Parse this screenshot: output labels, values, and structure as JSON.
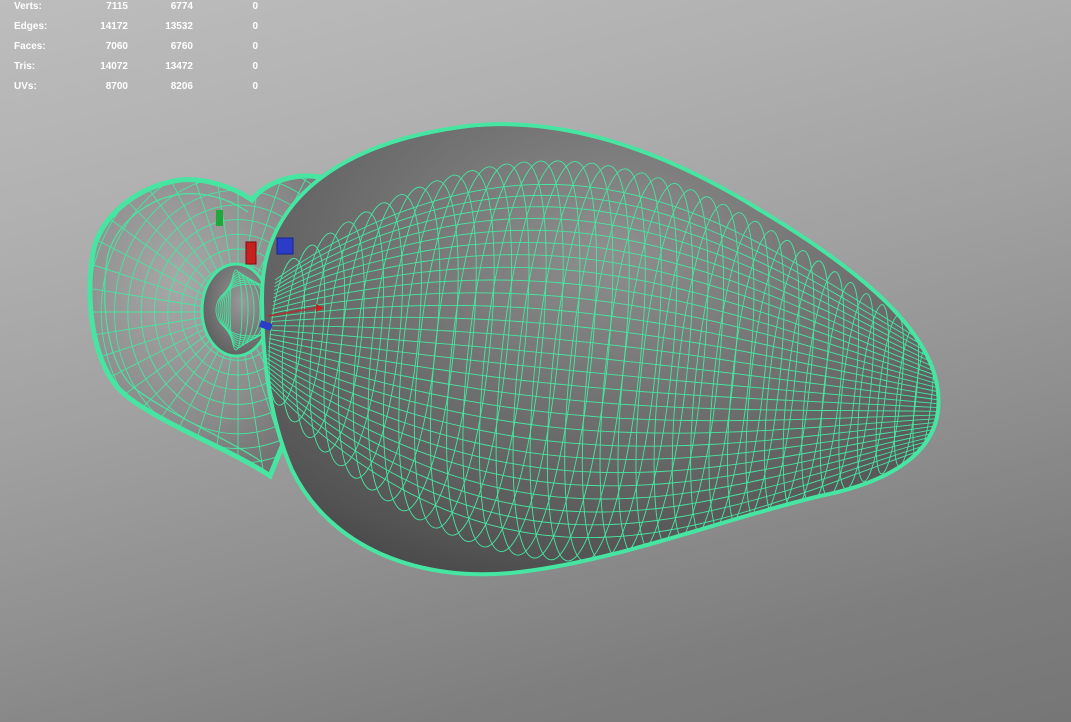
{
  "hud": {
    "rows": [
      {
        "label": "Verts:",
        "values": [
          "7115",
          "6774",
          "0"
        ]
      },
      {
        "label": "Edges:",
        "values": [
          "14172",
          "13532",
          "0"
        ]
      },
      {
        "label": "Faces:",
        "values": [
          "7060",
          "6760",
          "0"
        ]
      },
      {
        "label": "Tris:",
        "values": [
          "14072",
          "13472",
          "0"
        ]
      },
      {
        "label": "UVs:",
        "values": [
          "8700",
          "8206",
          "0"
        ]
      }
    ]
  },
  "viewport": {
    "wire_color": "#46e6a2",
    "manipulator_colors": {
      "x": "#c82020",
      "y": "#22a83a",
      "z": "#2a3cc8"
    }
  }
}
